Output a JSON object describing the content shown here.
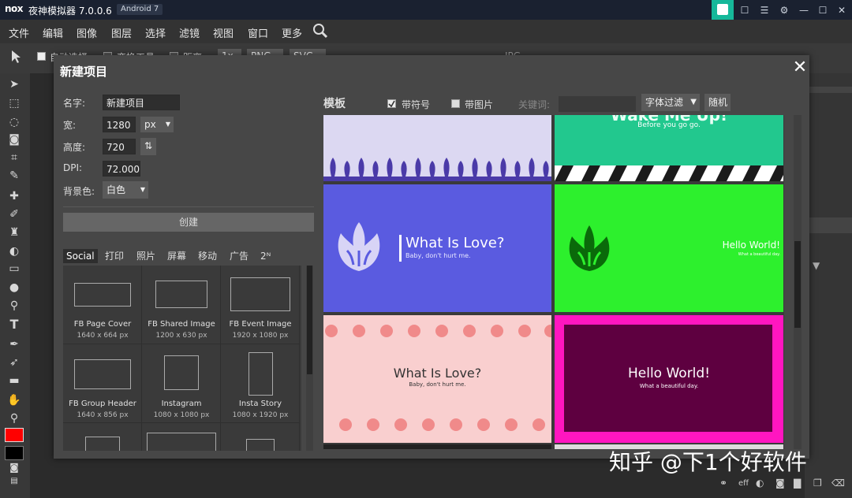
{
  "emulator": {
    "logo": "nox",
    "title": "夜神模拟器 7.0.0.6",
    "android_badge": "Android 7",
    "controls": [
      "☐",
      "☰",
      "⚙",
      "—",
      "☐",
      "✕"
    ]
  },
  "menu": [
    "文件",
    "编辑",
    "图像",
    "图层",
    "选择",
    "滤镜",
    "视图",
    "窗口",
    "更多"
  ],
  "options": {
    "auto_select": "自动选择",
    "transform": "变换工具",
    "distance": "距离",
    "zoom": "1x",
    "png": "PNG",
    "svg": "SVG",
    "jpg": "JPG"
  },
  "dialog": {
    "title": "新建项目",
    "close": "✕",
    "name_label": "名字:",
    "name_value": "新建项目",
    "width_label": "宽:",
    "width_value": "1280",
    "unit": "px",
    "height_label": "高度:",
    "height_value": "720",
    "dpi_label": "DPI:",
    "dpi_value": "72.000",
    "bg_label": "背景色:",
    "bg_value": "白色",
    "create": "创建",
    "categories": [
      "Social",
      "打印",
      "照片",
      "屏幕",
      "移动",
      "广告",
      "2ᴺ"
    ],
    "presets": [
      {
        "name": "FB Page Cover",
        "size": "1640 x 664 px"
      },
      {
        "name": "FB Shared Image",
        "size": "1200 x 630 px"
      },
      {
        "name": "FB Event Image",
        "size": "1920 x 1080 px"
      },
      {
        "name": "FB Group Header",
        "size": "1640 x 856 px"
      },
      {
        "name": "Instagram",
        "size": "1080 x 1080 px"
      },
      {
        "name": "Insta Story",
        "size": "1080 x 1920 px"
      }
    ],
    "templates_label": "模板",
    "with_symbols": "带符号",
    "with_images": "带图片",
    "keyword_label": "关键词:",
    "font_filter": "字体过滤",
    "random": "随机",
    "templates": [
      {
        "title": "",
        "subtitle": ""
      },
      {
        "title": "Wake Me Up!",
        "subtitle": "Before you go go."
      },
      {
        "title": "What Is Love?",
        "subtitle": "Baby, don't hurt me."
      },
      {
        "title": "Hello World!",
        "subtitle": "What a beautiful day."
      },
      {
        "title": "What Is Love?",
        "subtitle": "Baby, don't hurt me."
      },
      {
        "title": "Hello World!",
        "subtitle": "What a beautiful day."
      }
    ]
  },
  "watermark": "知乎 @下1个好软件",
  "colors": {
    "fg": "#ff0000",
    "bg": "#000000",
    "accent": "#16b89a"
  }
}
